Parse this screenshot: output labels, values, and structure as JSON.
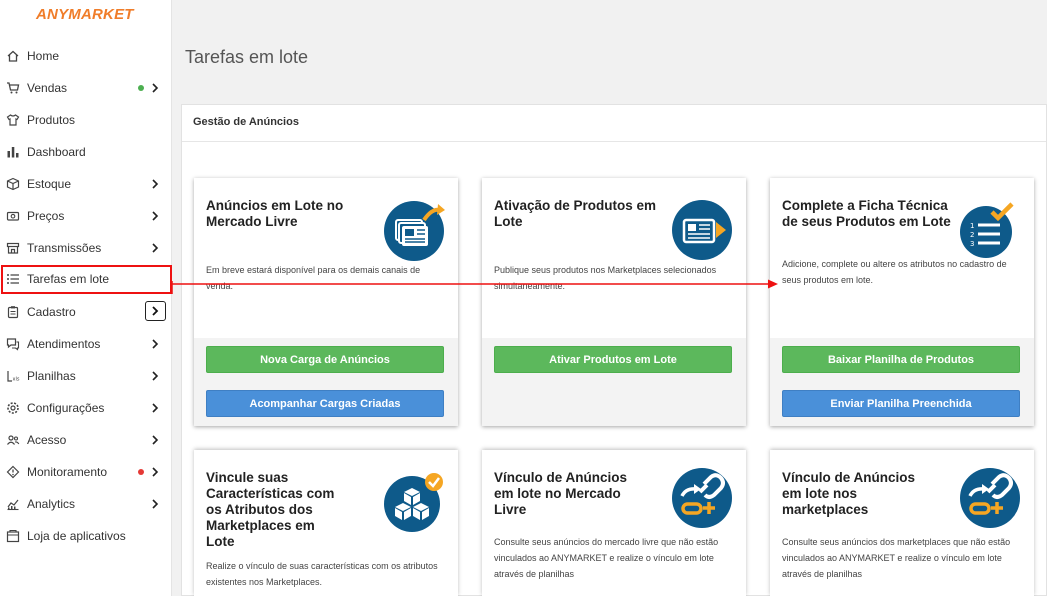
{
  "app": {
    "logo": "ANYMARKET"
  },
  "sidebar": {
    "items": [
      {
        "label": "Home",
        "icon": "home-icon",
        "chevron": false
      },
      {
        "label": "Vendas",
        "icon": "cart-icon",
        "chevron": true,
        "dot": "#4caf50"
      },
      {
        "label": "Produtos",
        "icon": "shirt-icon",
        "chevron": false
      },
      {
        "label": "Dashboard",
        "icon": "bar-chart-icon",
        "chevron": false
      },
      {
        "label": "Estoque",
        "icon": "box-icon",
        "chevron": true
      },
      {
        "label": "Preços",
        "icon": "price-tag-icon",
        "chevron": true
      },
      {
        "label": "Transmissões",
        "icon": "store-icon",
        "chevron": true
      },
      {
        "label": "Tarefas em lote",
        "icon": "list-icon",
        "chevron": false,
        "active": true
      },
      {
        "label": "Cadastro",
        "icon": "clipboard-icon",
        "chevron": true
      },
      {
        "label": "Atendimentos",
        "icon": "chat-icon",
        "chevron": true
      },
      {
        "label": "Planilhas",
        "icon": "spreadsheet-icon",
        "chevron": true
      },
      {
        "label": "Configurações",
        "icon": "gear-icon",
        "chevron": true
      },
      {
        "label": "Acesso",
        "icon": "users-icon",
        "chevron": true
      },
      {
        "label": "Monitoramento",
        "icon": "monitor-icon",
        "chevron": true,
        "dot": "#e53935"
      },
      {
        "label": "Analytics",
        "icon": "analytics-icon",
        "chevron": true
      },
      {
        "label": "Loja de aplicativos",
        "icon": "app-store-icon",
        "chevron": false
      }
    ]
  },
  "main": {
    "title": "Tarefas em lote",
    "section": "Gestão de Anúncios",
    "cards": [
      {
        "title": "Anúncios em Lote no Mercado Livre",
        "description": "Em breve estará disponível para os demais canais de venda.",
        "icon": "ads-upload-icon",
        "buttons": [
          {
            "label": "Nova Carga de Anúncios",
            "style": "green"
          },
          {
            "label": "Acompanhar Cargas Criadas",
            "style": "blue"
          }
        ]
      },
      {
        "title": "Ativação de Produtos em Lote",
        "description": "Publique seus produtos nos Marketplaces selecionados simultaneamente.",
        "icon": "product-activation-icon",
        "buttons": [
          {
            "label": "Ativar Produtos em Lote",
            "style": "green"
          }
        ]
      },
      {
        "title": "Complete a Ficha Técnica de seus Produtos em Lote",
        "description": "Adicione, complete ou altere os atributos no cadastro de seus produtos em lote.",
        "icon": "checklist-icon",
        "buttons": [
          {
            "label": "Baixar Planilha de Produtos",
            "style": "green"
          },
          {
            "label": "Enviar Planilha Preenchida",
            "style": "blue"
          }
        ]
      },
      {
        "title": "Vincule suas Características com os Atributos dos Marketplaces em Lote",
        "description": "Realize o vínculo de suas características com os atributos existentes nos Marketplaces.",
        "icon": "boxes-icon"
      },
      {
        "title": "Vínculo de Anúncios em lote no Mercado Livre",
        "description": "Consulte seus anúncios do mercado livre que não estão vinculados ao ANYMARKET e realize o vínculo em lote através de planilhas",
        "icon": "link-icon"
      },
      {
        "title": "Vínculo de Anúncios em lote nos marketplaces",
        "description": "Consulte seus anúncios dos marketplaces que não estão vinculados ao ANYMARKET e realize o vínculo em lote através de planilhas",
        "icon": "link-icon"
      }
    ]
  },
  "colors": {
    "brand": "#f07d2a",
    "badge": "#0e5a8a",
    "accent": "#f5a623",
    "green": "#5cb85c",
    "blue": "#4a90d9",
    "annotation": "#e11111"
  }
}
